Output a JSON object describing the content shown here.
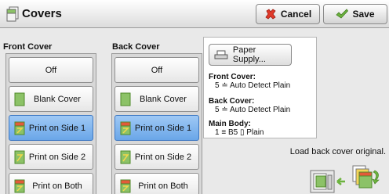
{
  "header": {
    "title": "Covers",
    "cancel_label": "Cancel",
    "save_label": "Save"
  },
  "front_cover": {
    "label": "Front Cover",
    "options": [
      "Off",
      "Blank Cover",
      "Print on Side 1",
      "Print on Side 2",
      "Print on Both"
    ],
    "selected": "Print on Side 1"
  },
  "back_cover": {
    "label": "Back Cover",
    "options": [
      "Off",
      "Blank Cover",
      "Print on Side 1",
      "Print on Side 2",
      "Print on Both"
    ],
    "selected": "Print on Side 1"
  },
  "panel": {
    "paper_supply_label": "Paper Supply...",
    "front_cover_key": "Front Cover:",
    "front_cover_value": "5 ≐ Auto Detect Plain",
    "back_cover_key": "Back Cover:",
    "back_cover_value": "5 ≐ Auto Detect Plain",
    "main_body_key": "Main Body:",
    "main_body_value": "1 ≡ B5 ▯ Plain"
  },
  "instruction": "Load back cover original.",
  "colors": {
    "selected_fill": "#6aa6e8",
    "cancel_icon": "#e03a2a",
    "save_icon": "#6db33f"
  },
  "icons": {
    "header": "document-pages-icon",
    "cancel": "x-icon",
    "save": "checkmark-pencil-icon",
    "paper_supply": "paper-tray-icon"
  }
}
